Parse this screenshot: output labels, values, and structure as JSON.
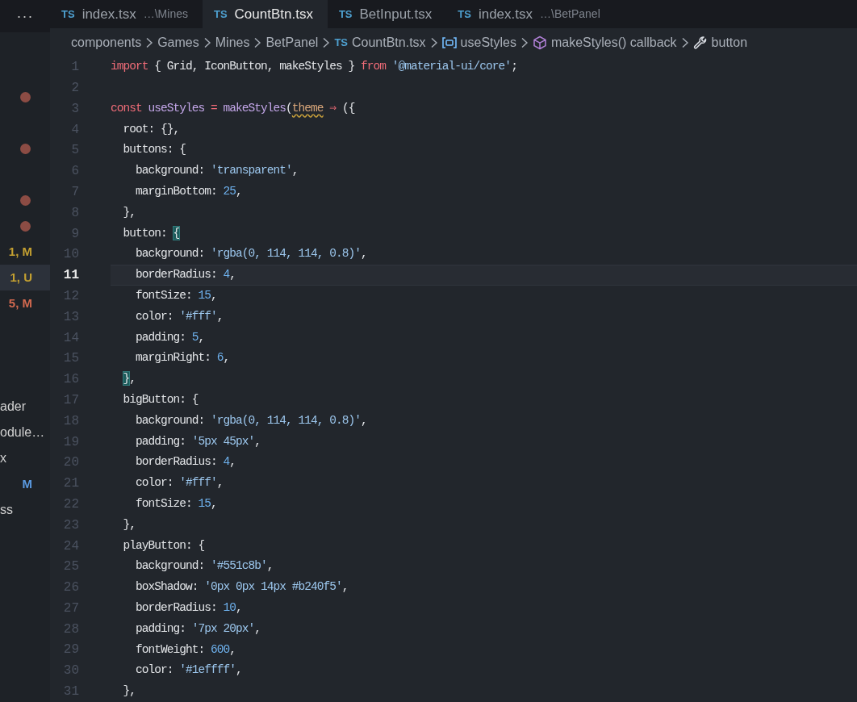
{
  "explorer_menu": "···",
  "tabs": [
    {
      "badge": "TS",
      "label": "index.tsx",
      "detail": "…\\Mines",
      "selected": false
    },
    {
      "badge": "TS",
      "label": "CountBtn.tsx",
      "selected": true
    },
    {
      "badge": "TS",
      "label": "BetInput.tsx",
      "selected": false
    },
    {
      "badge": "TS",
      "label": "index.tsx",
      "detail": "…\\BetPanel",
      "selected": false
    }
  ],
  "breadcrumbs": [
    {
      "kind": "folder",
      "label": "components"
    },
    {
      "kind": "folder",
      "label": "Games"
    },
    {
      "kind": "folder",
      "label": "Mines"
    },
    {
      "kind": "folder",
      "label": "BetPanel"
    },
    {
      "kind": "file",
      "badge": "TS",
      "label": "CountBtn.tsx"
    },
    {
      "kind": "variable",
      "label": "useStyles"
    },
    {
      "kind": "method",
      "label": "makeStyles() callback"
    },
    {
      "kind": "property",
      "label": "button"
    }
  ],
  "sidebar_groups": [
    [
      {
        "kind": "dot",
        "color": "#8c4c44",
        "selected": false
      }
    ],
    [
      {
        "kind": "dot",
        "color": "#8c4c44",
        "selected": false
      }
    ],
    [
      {
        "kind": "dot",
        "color": "#8c4c44",
        "selected": false
      },
      {
        "kind": "dot",
        "color": "#8c4c44",
        "selected": false
      },
      {
        "kind": "status",
        "status": "1, M",
        "color": "#c4a031",
        "selected": false
      },
      {
        "kind": "status",
        "status": "1, U",
        "color": "#c4a031",
        "selected": true
      },
      {
        "kind": "status",
        "status": "5, M",
        "color": "#d2694f",
        "selected": false
      }
    ],
    [
      {
        "kind": "file",
        "label": "ader",
        "selected": false
      },
      {
        "kind": "file",
        "label": "odule…",
        "selected": false
      },
      {
        "kind": "file",
        "label": "x",
        "selected": false
      },
      {
        "kind": "status",
        "status": "M",
        "color": "#5b9ae0",
        "selected": false
      },
      {
        "kind": "file",
        "label": "ss",
        "selected": false
      }
    ]
  ],
  "code_lines": [
    {
      "number": "1",
      "current": false,
      "tokens": [
        {
          "kind": "kw",
          "text": "import"
        },
        {
          "kind": "pl",
          "text": " { Grid, IconButton, makeStyles } "
        },
        {
          "kind": "kw",
          "text": "from "
        },
        {
          "kind": "str",
          "text": "'@material-ui/core'"
        },
        {
          "kind": "pl",
          "text": ";"
        }
      ]
    },
    {
      "number": "2",
      "current": false
    },
    {
      "number": "3",
      "current": false,
      "tokens": [
        {
          "kind": "kw",
          "text": "const "
        },
        {
          "kind": "fn",
          "text": "useStyles "
        },
        {
          "kind": "op",
          "text": "= "
        },
        {
          "kind": "fn",
          "text": "makeStyles"
        },
        {
          "kind": "pl",
          "text": "("
        },
        {
          "kind": "warn",
          "text": "theme"
        },
        {
          "kind": "op",
          "text": " ⇒ "
        },
        {
          "kind": "pl",
          "text": "({"
        }
      ]
    },
    {
      "number": "4",
      "current": false,
      "tokens": [
        {
          "kind": "pl",
          "text": "  root: {},"
        }
      ]
    },
    {
      "number": "5",
      "current": false,
      "tokens": [
        {
          "kind": "pl",
          "text": "  buttons: {"
        }
      ]
    },
    {
      "number": "6",
      "current": false,
      "tokens": [
        {
          "kind": "pl",
          "text": "    background: "
        },
        {
          "kind": "str",
          "text": "'transparent'"
        },
        {
          "kind": "pl",
          "text": ","
        }
      ]
    },
    {
      "number": "7",
      "current": false,
      "tokens": [
        {
          "kind": "pl",
          "text": "    marginBottom: "
        },
        {
          "kind": "num",
          "text": "25"
        },
        {
          "kind": "pl",
          "text": ","
        }
      ]
    },
    {
      "number": "8",
      "current": false,
      "tokens": [
        {
          "kind": "pl",
          "text": "  },"
        }
      ]
    },
    {
      "number": "9",
      "current": false,
      "tokens": [
        {
          "kind": "pl",
          "text": "  button: "
        },
        {
          "kind": "match",
          "text": "{"
        }
      ]
    },
    {
      "number": "10",
      "current": false,
      "tokens": [
        {
          "kind": "pl",
          "text": "    background: "
        },
        {
          "kind": "str",
          "text": "'rgba(0, 114, 114, 0.8)'"
        },
        {
          "kind": "pl",
          "text": ","
        }
      ]
    },
    {
      "number": "11",
      "current": true,
      "tokens": [
        {
          "kind": "pl",
          "text": "    borderRadius: "
        },
        {
          "kind": "num",
          "text": "4"
        },
        {
          "kind": "pl",
          "text": ","
        }
      ]
    },
    {
      "number": "12",
      "current": false,
      "tokens": [
        {
          "kind": "pl",
          "text": "    fontSize: "
        },
        {
          "kind": "num",
          "text": "15"
        },
        {
          "kind": "pl",
          "text": ","
        }
      ]
    },
    {
      "number": "13",
      "current": false,
      "tokens": [
        {
          "kind": "pl",
          "text": "    color: "
        },
        {
          "kind": "str",
          "text": "'#fff'"
        },
        {
          "kind": "pl",
          "text": ","
        }
      ]
    },
    {
      "number": "14",
      "current": false,
      "tokens": [
        {
          "kind": "pl",
          "text": "    padding: "
        },
        {
          "kind": "num",
          "text": "5"
        },
        {
          "kind": "pl",
          "text": ","
        }
      ]
    },
    {
      "number": "15",
      "current": false,
      "tokens": [
        {
          "kind": "pl",
          "text": "    marginRight: "
        },
        {
          "kind": "num",
          "text": "6"
        },
        {
          "kind": "pl",
          "text": ","
        }
      ]
    },
    {
      "number": "16",
      "current": false,
      "tokens": [
        {
          "kind": "match",
          "text": "  }"
        },
        {
          "kind": "pl",
          "text": ","
        }
      ]
    },
    {
      "number": "17",
      "current": false,
      "tokens": [
        {
          "kind": "pl",
          "text": "  bigButton: {"
        }
      ]
    },
    {
      "number": "18",
      "current": false,
      "tokens": [
        {
          "kind": "pl",
          "text": "    background: "
        },
        {
          "kind": "str",
          "text": "'rgba(0, 114, 114, 0.8)'"
        },
        {
          "kind": "pl",
          "text": ","
        }
      ]
    },
    {
      "number": "19",
      "current": false,
      "tokens": [
        {
          "kind": "pl",
          "text": "    padding: "
        },
        {
          "kind": "str",
          "text": "'5px 45px'"
        },
        {
          "kind": "pl",
          "text": ","
        }
      ]
    },
    {
      "number": "20",
      "current": false,
      "tokens": [
        {
          "kind": "pl",
          "text": "    borderRadius: "
        },
        {
          "kind": "num",
          "text": "4"
        },
        {
          "kind": "pl",
          "text": ","
        }
      ]
    },
    {
      "number": "21",
      "current": false,
      "tokens": [
        {
          "kind": "pl",
          "text": "    color: "
        },
        {
          "kind": "str",
          "text": "'#fff'"
        },
        {
          "kind": "pl",
          "text": ","
        }
      ]
    },
    {
      "number": "22",
      "current": false,
      "tokens": [
        {
          "kind": "pl",
          "text": "    fontSize: "
        },
        {
          "kind": "num",
          "text": "15"
        },
        {
          "kind": "pl",
          "text": ","
        }
      ]
    },
    {
      "number": "23",
      "current": false,
      "tokens": [
        {
          "kind": "pl",
          "text": "  },"
        }
      ]
    },
    {
      "number": "24",
      "current": false,
      "tokens": [
        {
          "kind": "pl",
          "text": "  playButton: {"
        }
      ]
    },
    {
      "number": "25",
      "current": false,
      "tokens": [
        {
          "kind": "pl",
          "text": "    background: "
        },
        {
          "kind": "str",
          "text": "'#551c8b'"
        },
        {
          "kind": "pl",
          "text": ","
        }
      ]
    },
    {
      "number": "26",
      "current": false,
      "tokens": [
        {
          "kind": "pl",
          "text": "    boxShadow: "
        },
        {
          "kind": "str",
          "text": "'0px 0px 14px #b240f5'"
        },
        {
          "kind": "pl",
          "text": ","
        }
      ]
    },
    {
      "number": "27",
      "current": false,
      "tokens": [
        {
          "kind": "pl",
          "text": "    borderRadius: "
        },
        {
          "kind": "num",
          "text": "10"
        },
        {
          "kind": "pl",
          "text": ","
        }
      ]
    },
    {
      "number": "28",
      "current": false,
      "tokens": [
        {
          "kind": "pl",
          "text": "    padding: "
        },
        {
          "kind": "str",
          "text": "'7px 20px'"
        },
        {
          "kind": "pl",
          "text": ","
        }
      ]
    },
    {
      "number": "29",
      "current": false,
      "tokens": [
        {
          "kind": "pl",
          "text": "    fontWeight: "
        },
        {
          "kind": "num",
          "text": "600"
        },
        {
          "kind": "pl",
          "text": ","
        }
      ]
    },
    {
      "number": "30",
      "current": false,
      "tokens": [
        {
          "kind": "pl",
          "text": "    color: "
        },
        {
          "kind": "str",
          "text": "'#1effff'"
        },
        {
          "kind": "pl",
          "text": ","
        }
      ]
    },
    {
      "number": "31",
      "current": false,
      "tokens": [
        {
          "kind": "pl",
          "text": "  },"
        }
      ]
    }
  ]
}
